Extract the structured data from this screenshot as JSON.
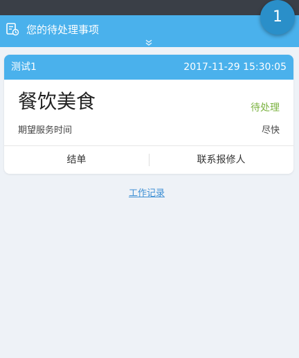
{
  "header": {
    "title": "您的待处理事项",
    "icon": "task-list-icon",
    "expand_icon": "chevron-double-down-icon"
  },
  "badge": {
    "count": "1"
  },
  "card": {
    "name": "测试1",
    "timestamp": "2017-11-29 15:30:05",
    "service": "餐饮美食",
    "status": "待处理",
    "time_label": "期望服务时间",
    "time_value": "尽快",
    "actions": {
      "close": "结单",
      "contact": "联系报修人"
    }
  },
  "work_log": "工作记录",
  "colors": {
    "accent": "#4ab1ec",
    "badge": "#2a8fc9",
    "status": "#7cb342",
    "link": "#3d8fd4",
    "background": "#eef2f7"
  }
}
